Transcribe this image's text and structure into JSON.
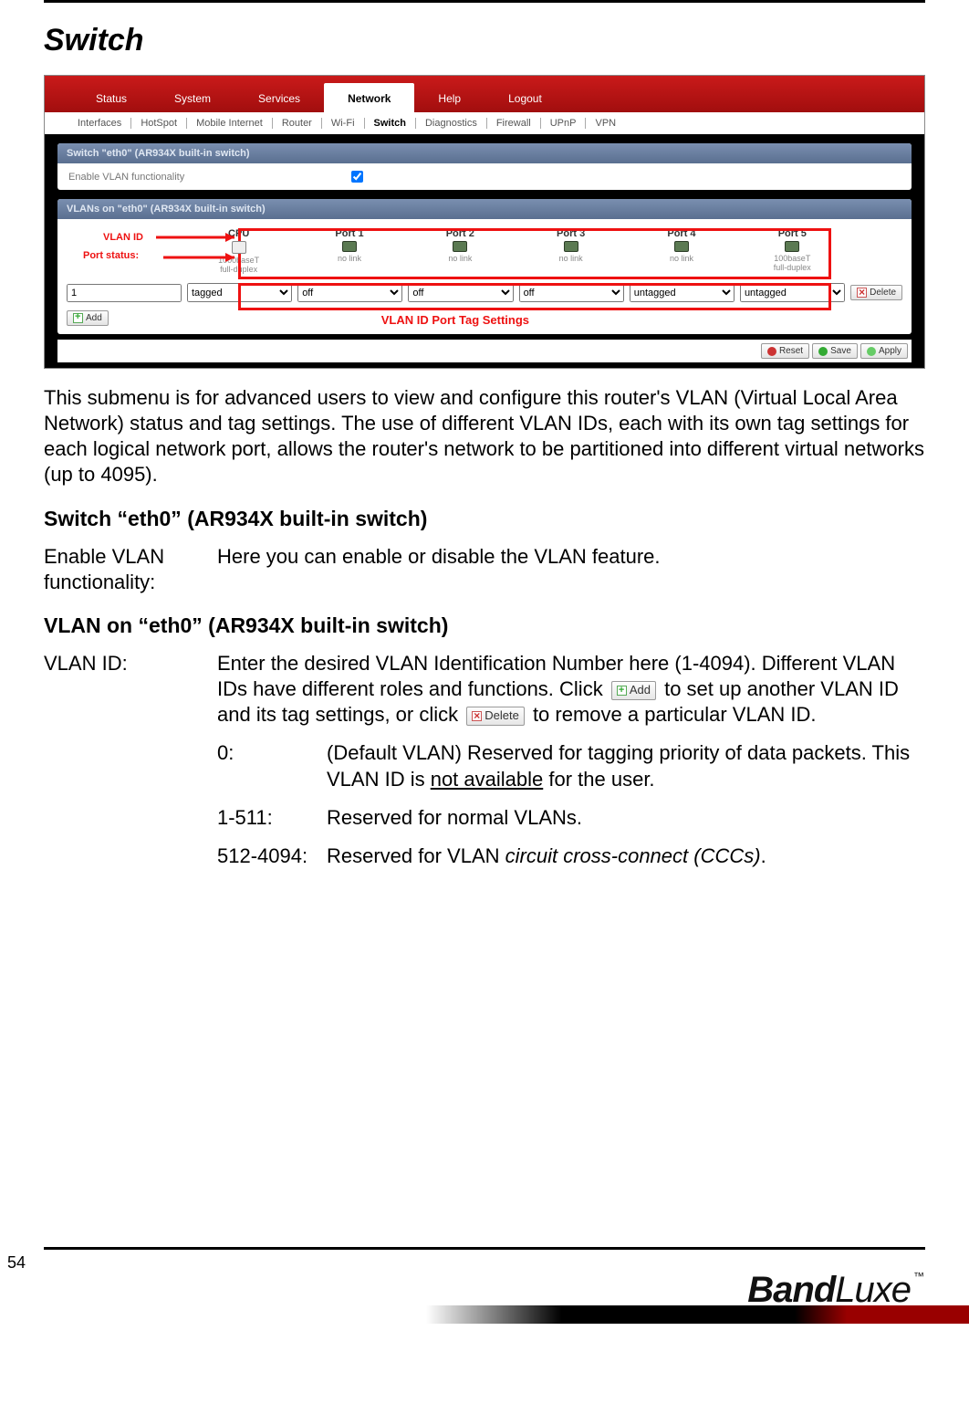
{
  "page": {
    "heading": "Switch",
    "number": "54",
    "brand": "BandLuxe",
    "tm": "™"
  },
  "router": {
    "mainTabs": [
      "Status",
      "System",
      "Services",
      "Network",
      "Help",
      "Logout"
    ],
    "activeMainTab": "Network",
    "subTabs": [
      "Interfaces",
      "HotSpot",
      "Mobile Internet",
      "Router",
      "Wi-Fi",
      "Switch",
      "Diagnostics",
      "Firewall",
      "UPnP",
      "VPN"
    ],
    "activeSubTab": "Switch",
    "panel1": {
      "title": "Switch \"eth0\" (AR934X built-in switch)",
      "enableLabel": "Enable VLAN functionality",
      "enableChecked": true
    },
    "panel2": {
      "title": "VLANs on \"eth0\" (AR934X built-in switch)",
      "annot": {
        "vlanId": "VLAN ID",
        "portStatus": "Port status:"
      },
      "columns": [
        {
          "h": "CPU",
          "sub": "1000baseT",
          "sub2": "full-duplex",
          "icon": "cpu"
        },
        {
          "h": "Port 1",
          "sub": "no link",
          "icon": "port"
        },
        {
          "h": "Port 2",
          "sub": "no link",
          "icon": "port"
        },
        {
          "h": "Port 3",
          "sub": "no link",
          "icon": "port"
        },
        {
          "h": "Port 4",
          "sub": "no link",
          "icon": "port"
        },
        {
          "h": "Port 5",
          "sub": "100baseT",
          "sub2": "full-duplex",
          "icon": "port"
        }
      ],
      "vlanIdValue": "1",
      "selects": [
        "tagged",
        "off",
        "off",
        "off",
        "untagged",
        "untagged"
      ],
      "deleteLabel": "Delete",
      "addLabel": "Add",
      "caption": "VLAN ID Port Tag Settings"
    },
    "footerButtons": {
      "reset": "Reset",
      "save": "Save",
      "apply": "Apply"
    }
  },
  "doc": {
    "intro": "This submenu is for advanced users to view and configure this router's VLAN (Virtual Local Area Network) status and tag settings. The use of different VLAN IDs, each with its own tag settings for each logical network port, allows the router's network to be partitioned into different virtual networks (up to 4095).",
    "section1": {
      "title": "Switch “eth0” (AR934X built-in switch)",
      "defLabel": "Enable VLAN functionality:",
      "defBody": "Here you can enable or disable the VLAN feature."
    },
    "section2": {
      "title": "VLAN on “eth0” (AR934X built-in switch)",
      "defLabel": "VLAN ID:",
      "p1a": "Enter the desired VLAN Identification Number here (1-4094). Different VLAN IDs have different roles and functions. Click ",
      "addBtn": "Add",
      "p1b": " to set up another VLAN ID and its tag settings, or click ",
      "delBtn": "Delete",
      "p1c": " to remove a particular VLAN ID.",
      "rows": [
        {
          "k": "0:",
          "v1": "(Default VLAN) Reserved for tagging priority of data packets. This VLAN ID is ",
          "u": "not available",
          "v2": " for the user."
        },
        {
          "k": "1-511:",
          "v": "Reserved for normal VLANs."
        },
        {
          "k": "512-4094:",
          "v1": "Reserved for VLAN ",
          "i": "circuit cross-connect (CCCs)",
          "v2": "."
        }
      ]
    }
  }
}
